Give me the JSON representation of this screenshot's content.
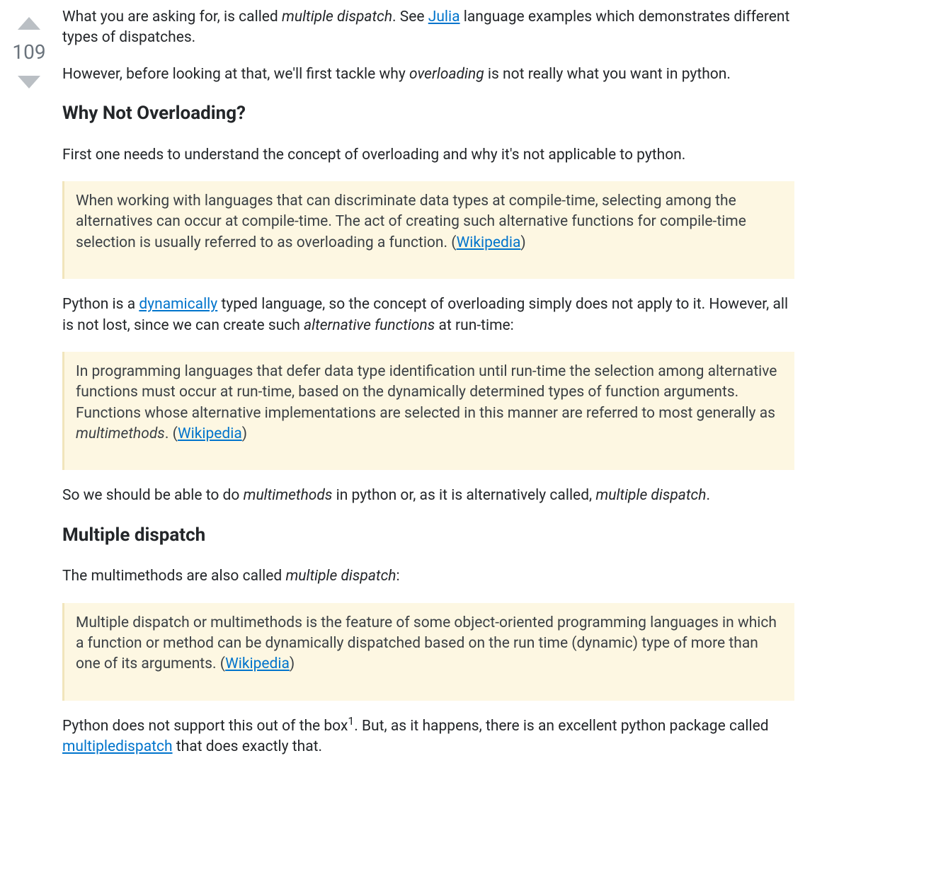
{
  "vote": {
    "count": "109"
  },
  "answer": {
    "intro": {
      "p1_pre": "What you are asking for, is called ",
      "p1_em": "multiple dispatch",
      "p1_mid": ". See ",
      "p1_link": "Julia",
      "p1_post": " language examples which demonstrates different types of dispatches.",
      "p2_pre": "However, before looking at that, we'll first tackle why ",
      "p2_em": "overloading",
      "p2_post": " is not really what you want in python."
    },
    "h1": "Why Not Overloading?",
    "s1": {
      "p1": "First one needs to understand the concept of overloading and why it's not applicable to python.",
      "q1_text": "When working with languages that can discriminate data types at compile-time, selecting among the alternatives can occur at compile-time. The act of creating such alternative functions for compile-time selection is usually referred to as overloading a function. (",
      "q1_link": "Wikipedia",
      "q1_close": ")",
      "p2_pre": "Python is a ",
      "p2_link": "dynamically",
      "p2_mid": " typed language, so the concept of overloading simply does not apply to it. However, all is not lost, since we can create such ",
      "p2_em": "alternative functions",
      "p2_post": " at run-time:",
      "q2_pre": "In programming languages that defer data type identification until run-time the selection among alternative functions must occur at run-time, based on the dynamically determined types of function arguments. Functions whose alternative implementations are selected in this manner are referred to most generally as ",
      "q2_em": "multimethods",
      "q2_mid": ". (",
      "q2_link": "Wikipedia",
      "q2_close": ")",
      "p3_pre": "So we should be able to do ",
      "p3_em1": "multimethods",
      "p3_mid": " in python or, as it is alternatively called, ",
      "p3_em2": "multiple dispatch",
      "p3_post": "."
    },
    "h2": "Multiple dispatch",
    "s2": {
      "p1_pre": "The multimethods are also called ",
      "p1_em": "multiple dispatch",
      "p1_post": ":",
      "q1_text": "Multiple dispatch or multimethods is the feature of some object-oriented programming languages in which a function or method can be dynamically dispatched based on the run time (dynamic) type of more than one of its arguments. (",
      "q1_link": "Wikipedia",
      "q1_close": ")",
      "p2_pre": "Python does not support this out of the box",
      "p2_sup": "1",
      "p2_mid": ". But, as it happens, there is an excellent python package called ",
      "p2_link": "multipledispatch",
      "p2_post": " that does exactly that."
    }
  }
}
